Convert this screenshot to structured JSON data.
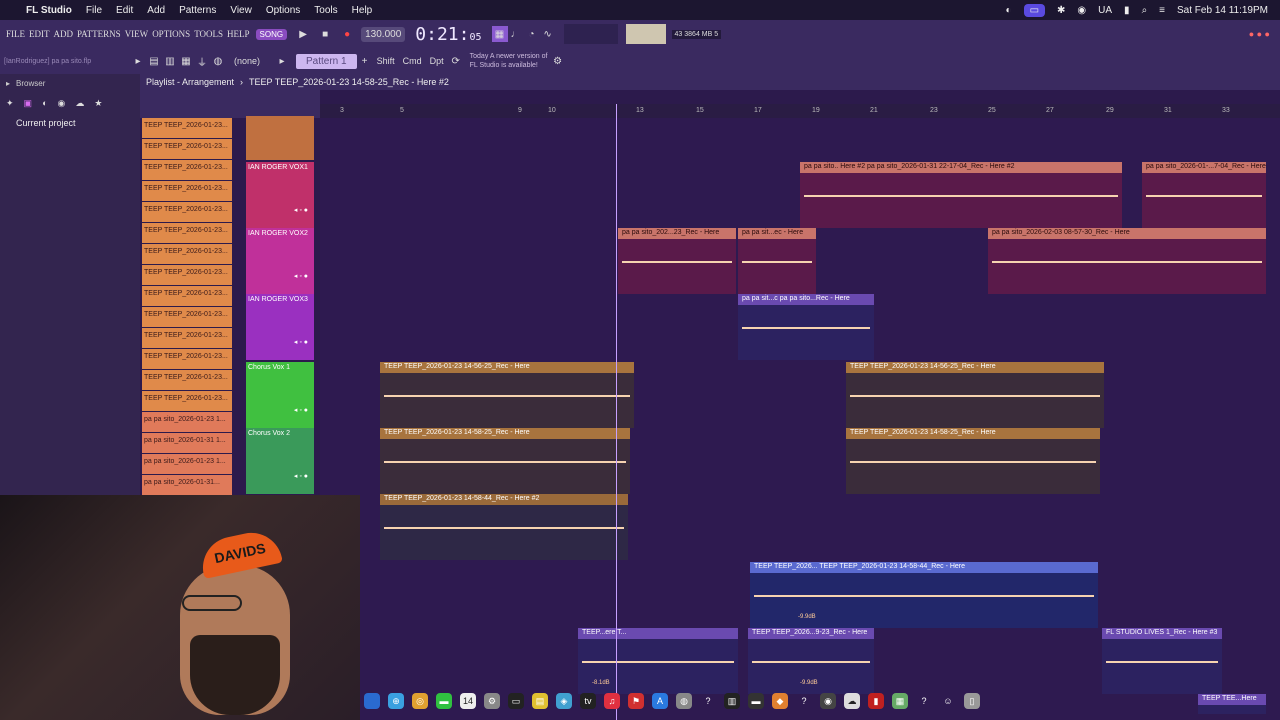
{
  "mac_menu": {
    "app": "FL Studio",
    "items": [
      "File",
      "Edit",
      "Add",
      "Patterns",
      "View",
      "Options",
      "Tools",
      "Help"
    ],
    "input_source": "UA",
    "datetime": "Sat Feb 14  11:19PM"
  },
  "fl_menu": [
    "FILE",
    "EDIT",
    "ADD",
    "PATTERNS",
    "VIEW",
    "OPTIONS",
    "TOOLS",
    "HELP"
  ],
  "transport": {
    "mode": "SONG",
    "tempo": "130.000",
    "time": "0:21",
    "time_small": "05",
    "cpu_a": "43",
    "mem": "3864 MB",
    "polyphony": "5"
  },
  "toolbar": {
    "hint": "[IanRodriguez] pa pa sito.flp",
    "snap": "(none)",
    "pattern": "Pattern 1",
    "shift": "Shift",
    "cmd": "Cmd",
    "dpt": "Dpt",
    "update": "Today  A newer version of FL Studio is available!"
  },
  "browser": {
    "title": "Browser",
    "current_project": "Current project"
  },
  "playlist": {
    "title": "Playlist - Arrangement",
    "path": "TEEP TEEP_2026-01-23 14-58-25_Rec - Here #2"
  },
  "ruler": [
    "3",
    "5",
    "9",
    "10",
    "13",
    "15",
    "17",
    "19",
    "21",
    "23",
    "25",
    "27",
    "29",
    "31",
    "33"
  ],
  "pattern_clips": [
    "TEEP TEEP_2026-01-23...",
    "TEEP TEEP_2026-01-23...",
    "TEEP TEEP_2026-01-23...",
    "TEEP TEEP_2026-01-23...",
    "TEEP TEEP_2026-01-23...",
    "TEEP TEEP_2026-01-23...",
    "TEEP TEEP_2026-01-23...",
    "TEEP TEEP_2026-01-23...",
    "TEEP TEEP_2026-01-23...",
    "TEEP TEEP_2026-01-23...",
    "TEEP TEEP_2026-01-23...",
    "TEEP TEEP_2026-01-23...",
    "TEEP TEEP_2026-01-23...",
    "TEEP TEEP_2026-01-23...",
    "pa pa sito_2026-01-23 1...",
    "pa pa sito_2026-01-31 1...",
    "pa pa sito_2026-01-23 1...",
    "pa pa sito_2026-01-31..."
  ],
  "tracks": [
    {
      "name": "IAN ROGER VOX1",
      "color": "#c0306a"
    },
    {
      "name": "IAN ROGER VOX2",
      "color": "#c0309a"
    },
    {
      "name": "IAN ROGER VOX3",
      "color": "#9a30c0"
    },
    {
      "name": "Chorus Vox 1",
      "color": "#40c040"
    },
    {
      "name": "Chorus Vox 2",
      "color": "#3a9a5a"
    }
  ],
  "clips": {
    "c1": "pa pa sito.. Here #2  pa pa sito_2026-01-31 22-17-04_Rec - Here #2",
    "c2": "pa pa sito_2026-01-...7-04_Rec - Here",
    "c3": "pa pa sito_202...23_Rec - Here",
    "c4": "pa pa sit...ec - Here",
    "c5": "pa pa sito_2026-02-03 08-57-30_Rec - Here",
    "c6": "pa pa sit...c  pa pa sito...Rec - Here",
    "c7": "TEEP TEEP_2026-01-23 14-56-25_Rec - Here",
    "c8": "TEEP TEEP_2026-01-23 14-56-25_Rec - Here",
    "c9": "TEEP TEEP_2026-01-23 14-58-25_Rec - Here",
    "c10": "TEEP TEEP_2026-01-23 14-58-25_Rec - Here",
    "c11": "TEEP TEEP_2026-01-23 14-58-44_Rec - Here #2",
    "c12": "TEEP TEEP_2026...  TEEP TEEP_2026-01-23 14-58-44_Rec - Here",
    "c13": "TEEP...ere  T...",
    "c14": "TEEP TEEP_2026...9-23_Rec - Here",
    "c15": "FL STUDIO LIVES 1_Rec - Here #3",
    "c16": "TEEP TEE...Here"
  },
  "db_labels": {
    "a": "-9.9dB",
    "b": "-8.1dB",
    "c": "-9.9dB"
  },
  "webcam": {
    "cap_text": "DAVIDS"
  },
  "dock_badge": "14"
}
